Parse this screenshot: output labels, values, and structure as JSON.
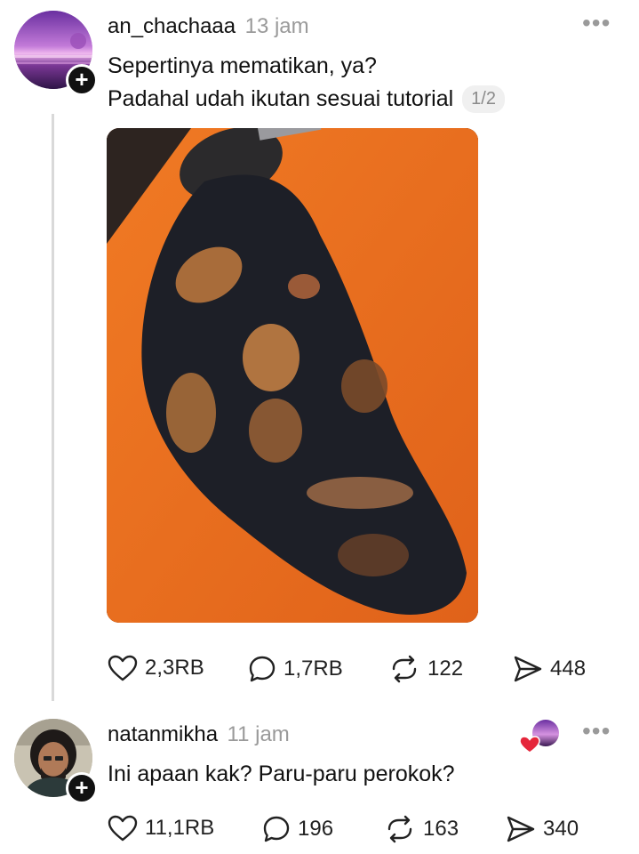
{
  "post": {
    "username": "an_chachaaa",
    "time": "13 jam",
    "line1": "Sepertinya mematikan, ya?",
    "line2": "Padahal udah ikutan sesuai tutorial",
    "counter": "1/2",
    "actions": {
      "likes": "2,3RB",
      "comments": "1,7RB",
      "reposts": "122",
      "shares": "448"
    }
  },
  "reply": {
    "username": "natanmikha",
    "time": "11 jam",
    "text": "Ini apaan kak? Paru-paru perokok?",
    "actions": {
      "likes": "11,1RB",
      "comments": "196",
      "reposts": "163",
      "shares": "340"
    }
  },
  "colors": {
    "plate": "#e96a1a",
    "heart_badge": "#e5263b"
  },
  "icons": [
    "plus-icon",
    "more-icon",
    "heart-icon",
    "comment-icon",
    "repost-icon",
    "share-icon"
  ]
}
